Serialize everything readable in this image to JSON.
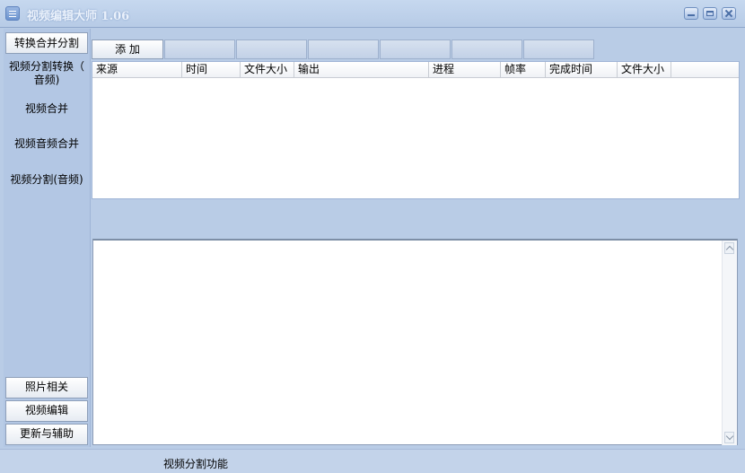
{
  "window": {
    "title": "视频编辑大师 1.06",
    "icon": "list-menu-icon",
    "controls": [
      "minimize-icon",
      "maximize-icon",
      "close-icon"
    ]
  },
  "sidebar": {
    "top_button": "转换合并分割",
    "nav_items": [
      {
        "line1": "视频分割转换（",
        "line2": "音频)"
      },
      {
        "line1": "视频合并"
      },
      {
        "line1": "视频音频合并"
      },
      {
        "line1": "视频分割(音频)"
      }
    ],
    "bottom_buttons": [
      "照片相关",
      "视频编辑",
      "更新与辅助"
    ]
  },
  "toolbar": {
    "add_label": "添 加"
  },
  "table": {
    "columns": [
      "来源",
      "时间",
      "文件大小",
      "输出",
      "进程",
      "帧率",
      "完成时间",
      "文件大小"
    ],
    "rows": []
  },
  "status": {
    "text": "视频分割功能"
  },
  "colors": {
    "background": "#b9cce6",
    "panel": "#b3c7e4",
    "table_bg": "#ffffff"
  }
}
